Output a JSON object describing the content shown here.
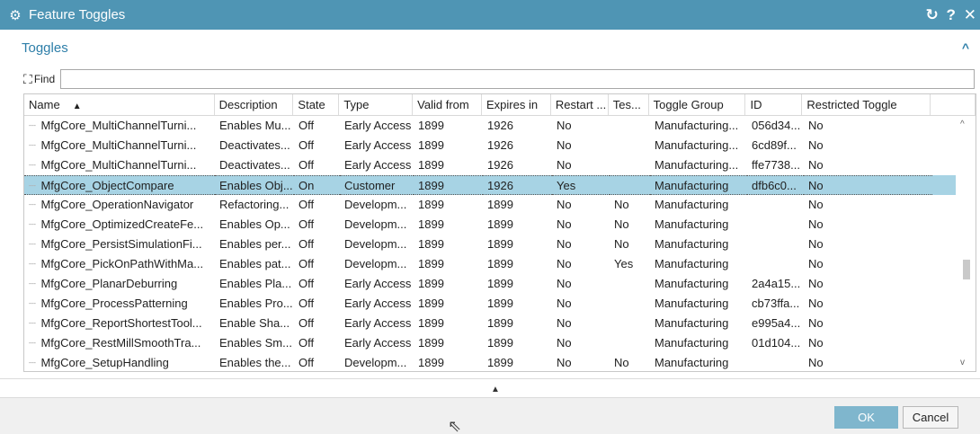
{
  "window": {
    "title": "Feature Toggles",
    "icon": "gear-icon",
    "controls": {
      "reset": "↻",
      "help": "?",
      "close": "✕"
    }
  },
  "section": {
    "label": "Toggles",
    "collapse": "^"
  },
  "find": {
    "label": "Find",
    "value": ""
  },
  "table": {
    "columns": [
      "Name",
      "Description",
      "State",
      "Type",
      "Valid from",
      "Expires in",
      "Restart ...",
      "Tes...",
      "Toggle Group",
      "ID",
      "Restricted Toggle"
    ],
    "sort_indicator": "▲",
    "rows": [
      [
        "MfgCore_MultiChannelTurni...",
        "Enables Mu...",
        "Off",
        "Early Access",
        "1899",
        "1926",
        "No",
        "",
        "Manufacturing...",
        "056d34...",
        "No"
      ],
      [
        "MfgCore_MultiChannelTurni...",
        "Deactivates...",
        "Off",
        "Early Access",
        "1899",
        "1926",
        "No",
        "",
        "Manufacturing...",
        "6cd89f...",
        "No"
      ],
      [
        "MfgCore_MultiChannelTurni...",
        "Deactivates...",
        "Off",
        "Early Access",
        "1899",
        "1926",
        "No",
        "",
        "Manufacturing...",
        "ffe7738...",
        "No"
      ],
      [
        "MfgCore_ObjectCompare",
        "Enables Obj...",
        "On",
        "Customer",
        "1899",
        "1926",
        "Yes",
        "",
        "Manufacturing",
        "dfb6c0...",
        "No"
      ],
      [
        "MfgCore_OperationNavigator",
        "Refactoring...",
        "Off",
        "Developm...",
        "1899",
        "1899",
        "No",
        "No",
        "Manufacturing",
        "",
        "No"
      ],
      [
        "MfgCore_OptimizedCreateFe...",
        "Enables Op...",
        "Off",
        "Developm...",
        "1899",
        "1899",
        "No",
        "No",
        "Manufacturing",
        "",
        "No"
      ],
      [
        "MfgCore_PersistSimulationFi...",
        "Enables per...",
        "Off",
        "Developm...",
        "1899",
        "1899",
        "No",
        "No",
        "Manufacturing",
        "",
        "No"
      ],
      [
        "MfgCore_PickOnPathWithMa...",
        "Enables pat...",
        "Off",
        "Developm...",
        "1899",
        "1899",
        "No",
        "Yes",
        "Manufacturing",
        "",
        "No"
      ],
      [
        "MfgCore_PlanarDeburring",
        "Enables Pla...",
        "Off",
        "Early Access",
        "1899",
        "1899",
        "No",
        "",
        "Manufacturing",
        "2a4a15...",
        "No"
      ],
      [
        "MfgCore_ProcessPatterning",
        "Enables Pro...",
        "Off",
        "Early Access",
        "1899",
        "1899",
        "No",
        "",
        "Manufacturing",
        "cb73ffa...",
        "No"
      ],
      [
        "MfgCore_ReportShortestTool...",
        "Enable Sha...",
        "Off",
        "Early Access",
        "1899",
        "1899",
        "No",
        "",
        "Manufacturing",
        "e995a4...",
        "No"
      ],
      [
        "MfgCore_RestMillSmoothTra...",
        "Enables Sm...",
        "Off",
        "Early Access",
        "1899",
        "1899",
        "No",
        "",
        "Manufacturing",
        "01d104...",
        "No"
      ],
      [
        "MfgCore_SetupHandling",
        "Enables the...",
        "Off",
        "Developm...",
        "1899",
        "1899",
        "No",
        "No",
        "Manufacturing",
        "",
        "No"
      ]
    ],
    "selected_row_index": 3,
    "scroll": {
      "up": "^",
      "down": "v"
    }
  },
  "expander": "▲",
  "buttons": {
    "ok": "OK",
    "cancel": "Cancel"
  },
  "colors": {
    "titlebar": "#4f95b4",
    "accent": "#2e7fa9",
    "selection": "#a7d3e4",
    "ok_button": "#7fb6cd"
  }
}
